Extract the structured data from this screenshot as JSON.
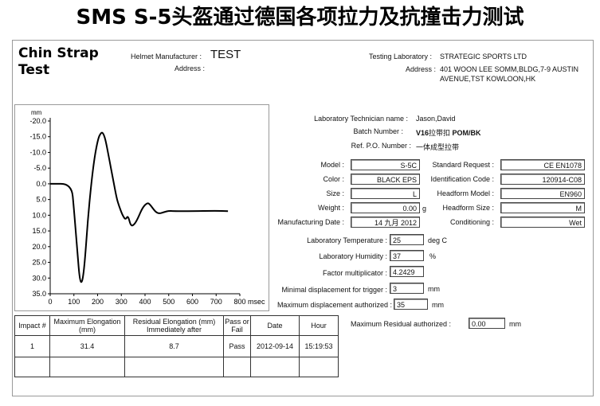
{
  "banner": "SMS S-5头盔通过德国各项拉力及抗撞击力测试",
  "report": {
    "title_line1": "Chin Strap",
    "title_line2": "Test",
    "helmet_manufacturer_label": "Helmet Manufacturer :",
    "helmet_manufacturer": "TEST",
    "address_label": "Address :",
    "testing_lab_label": "Testing Laboratory :",
    "testing_lab": "STRATEGIC SPORTS LTD",
    "lab_address_label": "Address :",
    "lab_address_line1": "401 WOON LEE SOMM,BLDG,7-9 AUSTIN",
    "lab_address_line2": "AVENUE,TST KOWLOON,HK"
  },
  "info": {
    "technician_label": "Laboratory Technician name :",
    "technician": "Jason,David",
    "batch_label": "Batch Number :",
    "batch_bold": "V16",
    "batch_mid": "拉带扣",
    "batch_bold2": "POM/BK",
    "po_label": "Ref. P.O. Number :",
    "po": "一体成型拉带"
  },
  "specs": {
    "model_label": "Model :",
    "model": "S-5C",
    "standard_label": "Standard Request :",
    "standard": "CE EN1078",
    "color_label": "Color :",
    "color": "BLACK EPS",
    "idcode_label": "Identification Code :",
    "idcode": "120914-C08",
    "size_label": "Size :",
    "size": "L",
    "headform_model_label": "Headform Model :",
    "headform_model": "EN960",
    "weight_label": "Weight :",
    "weight": "0.00",
    "weight_unit": "g",
    "headform_size_label": "Headform Size :",
    "headform_size": "M",
    "mfg_date_label": "Manufacturing Date :",
    "mfg_date": "14 九月 2012",
    "conditioning_label": "Conditioning :",
    "conditioning": "Wet"
  },
  "lab": {
    "temp_label": "Laboratory Temperature :",
    "temp": "25",
    "temp_unit": "deg C",
    "humidity_label": "Laboratory Humidity :",
    "humidity": "37",
    "humidity_unit": "%",
    "factor_label": "Factor multiplicator :",
    "factor": "4.2429",
    "min_disp_label": "Minimal displacement for trigger :",
    "min_disp": "3",
    "min_disp_unit": "mm",
    "max_disp_label": "Maximum displacement authorized :",
    "max_disp": "35",
    "max_disp_unit": "mm",
    "max_resid_label": "Maximum Residual authorized :",
    "max_resid": "0.00",
    "max_resid_unit": "mm"
  },
  "table": {
    "headers": [
      "Impact #",
      "Maximum Elongation (mm)",
      "Residual Elongation (mm) Immediately after",
      "Pass or Fail",
      "Date",
      "Hour"
    ],
    "h1": "Impact #",
    "h2a": "Maximum Elongation",
    "h2b": "(mm)",
    "h3a": "Residual Elongation (mm)",
    "h3b": "Immediately after",
    "h4a": "Pass or",
    "h4b": "Fail",
    "h5": "Date",
    "h6": "Hour",
    "rows": [
      {
        "impact": "1",
        "max_elong": "31.4",
        "residual": "8.7",
        "pass": "Pass",
        "date": "2012-09-14",
        "hour": "15:19:53"
      }
    ]
  },
  "chart_data": {
    "type": "line",
    "ylabel": "mm",
    "xlabel": "msec",
    "ylim": [
      -20,
      35
    ],
    "xlim": [
      0,
      800
    ],
    "y_inverted": true,
    "yticks": [
      "-20.0",
      "-15.0",
      "-10.0",
      "-5.0",
      "0.0",
      "5.0",
      "10.0",
      "15.0",
      "20.0",
      "25.0",
      "30.0",
      "35.0"
    ],
    "xticks": [
      "0",
      "100",
      "200",
      "300",
      "400",
      "500",
      "600",
      "700",
      "800"
    ],
    "series": [
      {
        "color": "#000000",
        "x": [
          0,
          90,
          100,
          115,
          125,
          135,
          145,
          160,
          180,
          200,
          215,
          225,
          235,
          250,
          265,
          280,
          290,
          305,
          318,
          328,
          340,
          355,
          370,
          390,
          410,
          420,
          430,
          445,
          460,
          480,
          500,
          520,
          560,
          600,
          700,
          750
        ],
        "y": [
          0.0,
          0.0,
          8.0,
          22.0,
          31.0,
          31.5,
          26.0,
          10.0,
          -5.0,
          -14.0,
          -16.5,
          -16.0,
          -13.5,
          -7.5,
          -1.5,
          4.5,
          7.0,
          10.0,
          11.5,
          10.0,
          13.5,
          13.0,
          11.0,
          7.5,
          6.0,
          6.5,
          7.5,
          9.0,
          9.5,
          9.0,
          8.6,
          8.7,
          8.7,
          8.7,
          8.6,
          8.7
        ]
      }
    ]
  }
}
